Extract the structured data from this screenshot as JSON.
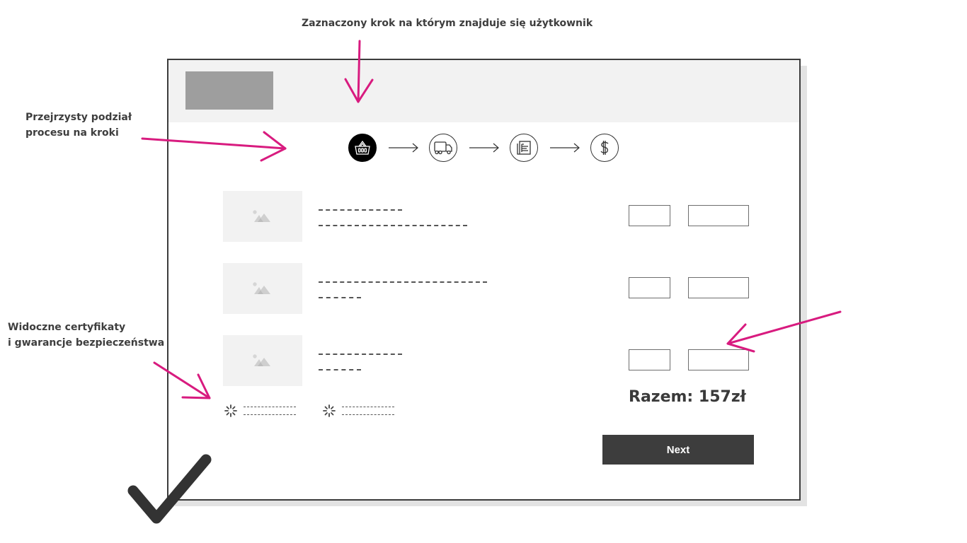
{
  "annotations": {
    "current_step": "Zaznaczony krok na którym znajduje się użytkownik",
    "steps_division_line1": "Przejrzysty podział",
    "steps_division_line2": "procesu na kroki",
    "certificates_line1": "Widoczne certyfikaty",
    "certificates_line2": "i gwarancje bezpieczeństwa"
  },
  "colors": {
    "annotation_arrow": "#d81b7f",
    "frame": "#3c3c3c",
    "header_bg": "#f2f2f2",
    "logo_placeholder": "#9e9e9e",
    "button_bg": "#3d3d3d",
    "checkmark": "#333333"
  },
  "steps": [
    {
      "icon": "basket-icon",
      "name": "cart",
      "active": true
    },
    {
      "icon": "truck-icon",
      "name": "delivery",
      "active": false
    },
    {
      "icon": "document-icon",
      "name": "details",
      "active": false
    },
    {
      "icon": "dollar-icon",
      "name": "payment",
      "active": false
    }
  ],
  "cart_items": [
    {
      "image": "image-placeholder-icon",
      "qty": "",
      "price": ""
    },
    {
      "image": "image-placeholder-icon",
      "qty": "",
      "price": ""
    },
    {
      "image": "image-placeholder-icon",
      "qty": "",
      "price": ""
    }
  ],
  "certificates": [
    {
      "icon": "spinner-icon"
    },
    {
      "icon": "spinner-icon"
    }
  ],
  "summary": {
    "total_label": "Razem: 157zł"
  },
  "actions": {
    "next_label": "Next"
  },
  "verdict": {
    "icon": "checkmark-icon"
  }
}
